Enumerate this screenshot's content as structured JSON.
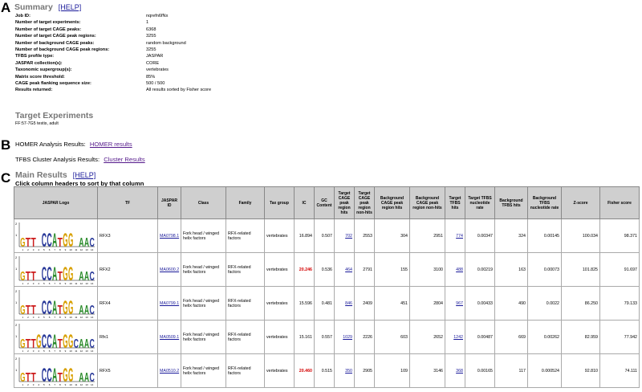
{
  "panels": {
    "a": "A",
    "b": "B",
    "c": "C"
  },
  "summary": {
    "title": "Summary",
    "help": "[HELP]",
    "rows": [
      {
        "k": "Job ID:",
        "v": "nqrefn6fNx"
      },
      {
        "k": "Number of target experiments:",
        "v": "1"
      },
      {
        "k": "Number of target CAGE peaks:",
        "v": "6368"
      },
      {
        "k": "Number of target CAGE peak regions:",
        "v": "3255"
      },
      {
        "k": "Number of background CAGE peaks:",
        "v": "random background"
      },
      {
        "k": "Number of background CAGE peak regions:",
        "v": "3255"
      },
      {
        "k": "TFBS profile type:",
        "v": "JASPAR"
      },
      {
        "k": "JASPAR collection(s):",
        "v": "CORE"
      },
      {
        "k": "Taxonomic supergroup(s):",
        "v": "vertebrates"
      },
      {
        "k": "Matrix score threshold:",
        "v": "85%"
      },
      {
        "k": "CAGE peak flanking sequence size:",
        "v": "500 / 500"
      },
      {
        "k": "Results returned:",
        "v": "All results sorted by Fisher score"
      }
    ]
  },
  "target_experiments": {
    "title": "Target Experiments",
    "text": "FF:57-7G5 testis, adult"
  },
  "homer": {
    "label": "HOMER Analysis Results:",
    "link": "HOMER results"
  },
  "cluster": {
    "label": "TFBS Cluster Analysis Results:",
    "link": "Cluster Results"
  },
  "main_results": {
    "title": "Main Results",
    "help": "[HELP]",
    "note": "Click column headers to sort by that column",
    "headers": [
      "JASPAR Logo",
      "TF",
      "JASPAR ID",
      "Class",
      "Family",
      "Tax group",
      "IC",
      "GC Content",
      "Target CAGE peak region hits",
      "Target CAGE peak region non-hits",
      "Background CAGE peak region hits",
      "Background CAGE peak region non-hits",
      "Target TFBS hits",
      "Target TFBS nucleotide rate",
      "Background TFBS hits",
      "Background TFBS nucleotide rate",
      "Z-score",
      "Fisher score"
    ],
    "rows": [
      {
        "tf": "RFX3",
        "id": "MA0798.1",
        "cls": "Fork head / winged helix factors",
        "family": "RFX-related factors",
        "tax": "vertebrates",
        "ic": "16.894",
        "ic_red": false,
        "gc": "0.507",
        "tgt_hits": "702",
        "tgt_non": "2553",
        "bg_hits": "304",
        "bg_non": "2951",
        "tfbs_hits": "774",
        "tfbs_rate": "0.00347",
        "bg_tfbs_hits": "324",
        "bg_tfbs_rate": "0.00145",
        "z": "100.034",
        "fisher": "98.371",
        "logo": "GTT.CCATGG.AAC"
      },
      {
        "tf": "RFX2",
        "id": "MA0600.2",
        "cls": "Fork head / winged helix factors",
        "family": "RFX-related factors",
        "tax": "vertebrates",
        "ic": "20.246",
        "ic_red": true,
        "gc": "0.536",
        "tgt_hits": "464",
        "tgt_non": "2791",
        "bg_hits": "155",
        "bg_non": "3100",
        "tfbs_hits": "488",
        "tfbs_rate": "0.00219",
        "bg_tfbs_hits": "163",
        "bg_tfbs_rate": "0.00073",
        "z": "101.825",
        "fisher": "91.697",
        "logo": "GTT.CCATGG.AAC"
      },
      {
        "tf": "RFX4",
        "id": "MA0799.1",
        "cls": "Fork head / winged helix factors",
        "family": "RFX-related factors",
        "tax": "vertebrates",
        "ic": "15.596",
        "ic_red": false,
        "gc": "0.481",
        "tgt_hits": "846",
        "tgt_non": "2409",
        "bg_hits": "451",
        "bg_non": "2804",
        "tfbs_hits": "967",
        "tfbs_rate": "0.00433",
        "bg_tfbs_hits": "490",
        "bg_tfbs_rate": "0.0022",
        "z": "86.250",
        "fisher": "79.133",
        "logo": "GTT.CCATGG.AAC"
      },
      {
        "tf": "Rfx1",
        "id": "MA0509.1",
        "cls": "Fork head / winged helix factors",
        "family": "RFX-related factors",
        "tax": "vertebrates",
        "ic": "15.161",
        "ic_red": false,
        "gc": "0.557",
        "tgt_hits": "1029",
        "tgt_non": "2226",
        "bg_hits": "603",
        "bg_non": "2652",
        "tfbs_hits": "1242",
        "tfbs_rate": "0.00487",
        "bg_tfbs_hits": "669",
        "bg_tfbs_rate": "0.00262",
        "z": "82.959",
        "fisher": "77.942",
        "logo": "GTTGCCATGGCAAC"
      },
      {
        "tf": "RFX5",
        "id": "MA0510.2",
        "cls": "Fork head / winged helix factors",
        "family": "RFX-related factors",
        "tax": "vertebrates",
        "ic": "20.460",
        "ic_red": true,
        "gc": "0.515",
        "tgt_hits": "350",
        "tgt_non": "2905",
        "bg_hits": "109",
        "bg_non": "3146",
        "tfbs_hits": "368",
        "tfbs_rate": "0.00165",
        "bg_tfbs_hits": "117",
        "bg_tfbs_rate": "0.000524",
        "z": "92.810",
        "fisher": "74.111",
        "logo": "GTT.CCATGG.AAC"
      }
    ]
  },
  "colors": {
    "A": "#2a8a2a",
    "C": "#2a3a9a",
    "G": "#d8a000",
    "T": "#cc1a1a"
  }
}
